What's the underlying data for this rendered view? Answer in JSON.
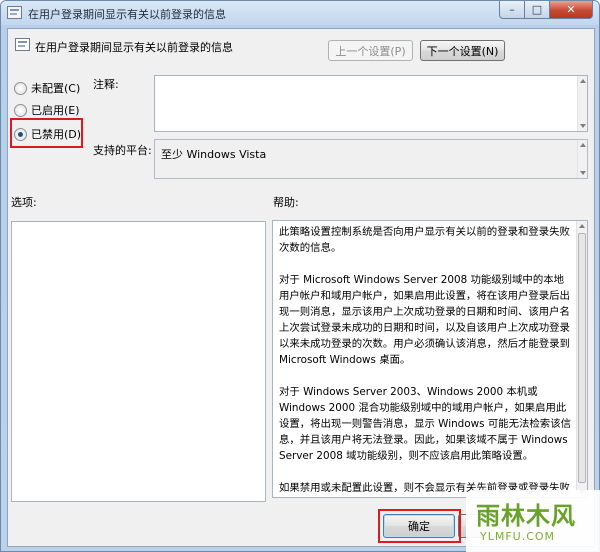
{
  "window": {
    "title": "在用户登录期间显示有关以前登录的信息",
    "icon": "policy-setting-icon",
    "controls": {
      "minimize": "–",
      "maximize": "□",
      "close": "✕"
    }
  },
  "header": {
    "setting_name": "在用户登录期间显示有关以前登录的信息",
    "prev_button": "上一个设置(P)",
    "next_button": "下一个设置(N)"
  },
  "state_options": [
    {
      "label": "未配置(C)",
      "checked": false
    },
    {
      "label": "已启用(E)",
      "checked": false
    },
    {
      "label": "已禁用(D)",
      "checked": true
    }
  ],
  "comment": {
    "label": "注释:",
    "value": ""
  },
  "platform": {
    "label": "支持的平台:",
    "value": "至少 Windows Vista"
  },
  "options": {
    "label": "选项:"
  },
  "help": {
    "label": "帮助:",
    "paragraphs": [
      "此策略设置控制系统是否向用户显示有关以前的登录和登录失败次数的信息。",
      "对于 Microsoft Windows Server 2008 功能级别域中的本地用户帐户和域用户帐户，如果启用此设置，将在该用户登录后出现一则消息，显示该用户上次成功登录的日期和时间、该用户名上次尝试登录未成功的日期和时间，以及自该用户上次成功登录以来未成功登录的次数。用户必须确认该消息，然后才能登录到 Microsoft Windows 桌面。",
      "对于 Windows Server 2003、Windows 2000 本机或 Windows 2000 混合功能级别域中的域用户帐户，如果启用此设置，将出现一则警告消息，显示 Windows 可能无法检索该信息，并且该用户将无法登录。因此，如果该域不属于 Windows Server 2008 域功能级别，则不应该启用此策略设置。",
      "如果禁用或未配置此设置，则不会显示有关先前登录或登录失败的消息。"
    ]
  },
  "footer": {
    "ok_button": "确定",
    "cancel_button": ""
  },
  "watermark": {
    "main": "雨林木风",
    "sub": "YLMFU.COM"
  },
  "colors": {
    "highlight_red": "#e0191c",
    "title_blue": "#c2d6ee",
    "watermark_green": "#6aa12b"
  }
}
